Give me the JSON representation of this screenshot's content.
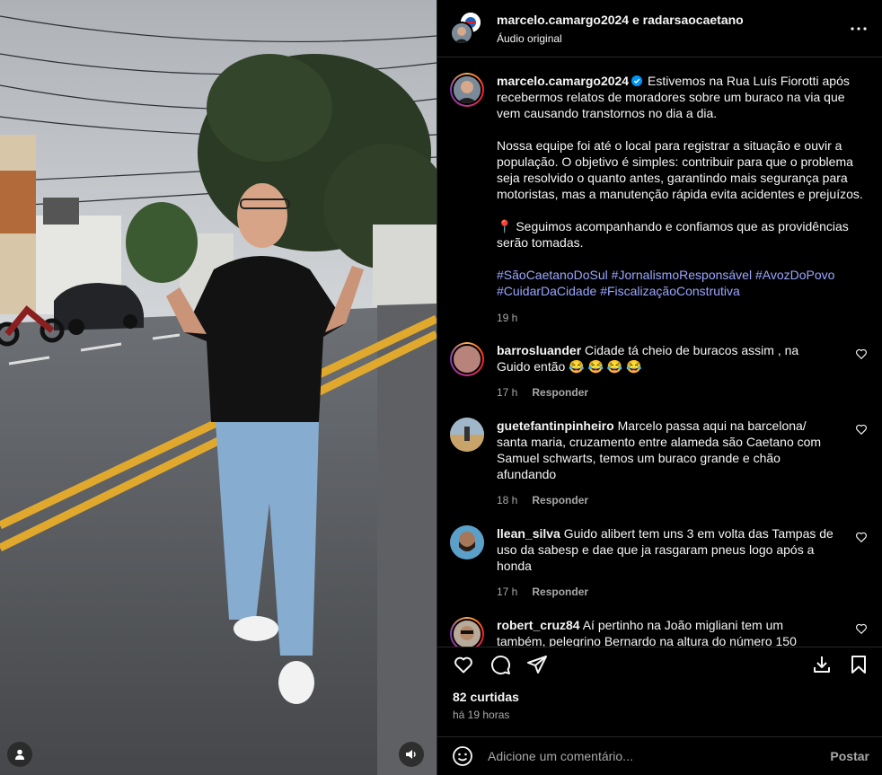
{
  "header": {
    "title": "marcelo.camargo2024 e radarsaocaetano",
    "subtitle": "Áudio original",
    "more_icon": "more-horizontal-icon"
  },
  "post": {
    "username": "marcelo.camargo2024",
    "verified": true,
    "caption_p1": "Estivemos na Rua Luís Fiorotti após recebermos relatos de moradores sobre um buraco na via que vem causando transtornos no dia a dia.",
    "caption_p2": "Nossa equipe foi até o local para registrar a situação e ouvir a população. O objetivo é simples: contribuir para que o problema seja resolvido o quanto antes, garantindo mais segurança para motoristas, mas a manutenção rápida evita acidentes e prejuízos.",
    "caption_p3": "📍 Seguimos acompanhando e confiamos que as providências serão tomadas.",
    "hashtags": [
      "#SãoCaetanoDoSul",
      "#JornalismoResponsável",
      "#AvozDoPovo",
      "#CuidarDaCidade",
      "#FiscalizaçãoConstrutiva"
    ],
    "time": "19 h"
  },
  "comments": [
    {
      "username": "barrosluander",
      "text": "Cidade tá cheio de buracos assim , na Guido então 😂 😂 😂 😂",
      "time": "17 h",
      "reply": "Responder",
      "avatar_color": "#b7837a"
    },
    {
      "username": "guetefantinpinheiro",
      "text": "Marcelo passa aqui na barcelona/ santa maria, cruzamento entre alameda são Caetano com Samuel schwarts, temos um buraco grande e chão afundando",
      "time": "18 h",
      "reply": "Responder",
      "avatar_color": "#8a7a5c"
    },
    {
      "username": "llean_silva",
      "text": "Guido alibert tem uns 3 em volta das Tampas de uso da sabesp e dae que ja rasgaram pneus logo após a honda",
      "time": "17 h",
      "reply": "Responder",
      "avatar_color": "#6b4f3a"
    },
    {
      "username": "robert_cruz84",
      "text": "Aí pertinho na João migliani tem um também, pelegrino Bernardo na altura do número 150 também tem, a cidade está parecendo um queijo suíço",
      "time": "",
      "reply": "",
      "avatar_color": "#9a8676"
    }
  ],
  "actions": {
    "like_icon": "heart-icon",
    "comment_icon": "comment-icon",
    "share_icon": "send-icon",
    "download_icon": "download-icon",
    "save_icon": "bookmark-icon"
  },
  "likes": "82 curtidas",
  "ago": "há 19 horas",
  "composer": {
    "placeholder": "Adicione um comentário...",
    "post_label": "Postar"
  },
  "colors": {
    "background": "#000000",
    "text": "#f5f5f5",
    "muted": "#a8a8a8",
    "hashtag": "#9aa6ff",
    "verified": "#0095f6"
  }
}
